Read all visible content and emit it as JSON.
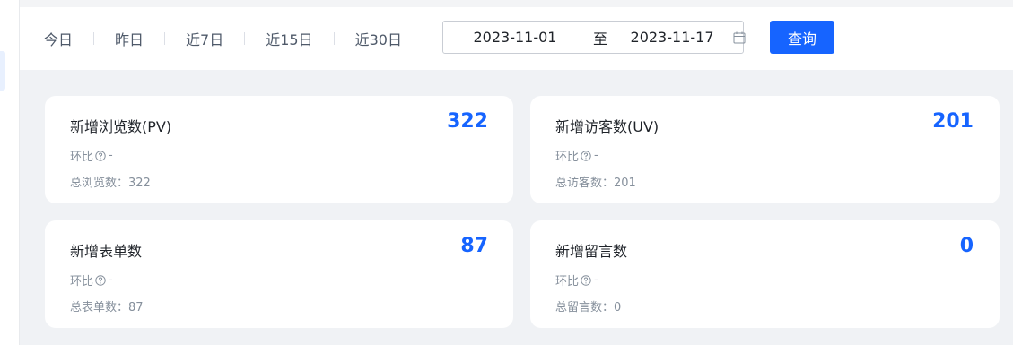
{
  "filters": {
    "ranges": [
      "今日",
      "昨日",
      "近7日",
      "近15日",
      "近30日"
    ],
    "start_date": "2023-11-01",
    "separator": "至",
    "end_date": "2023-11-17",
    "query_label": "查询"
  },
  "cards": [
    {
      "title": "新增浏览数(PV)",
      "value": "322",
      "ratio_label": "环比",
      "ratio_value": "-",
      "total_label": "总浏览数：",
      "total_value": "322"
    },
    {
      "title": "新增访客数(UV)",
      "value": "201",
      "ratio_label": "环比",
      "ratio_value": "-",
      "total_label": "总访客数：",
      "total_value": "201"
    },
    {
      "title": "新增表单数",
      "value": "87",
      "ratio_label": "环比",
      "ratio_value": "-",
      "total_label": "总表单数：",
      "total_value": "87"
    },
    {
      "title": "新增留言数",
      "value": "0",
      "ratio_label": "环比",
      "ratio_value": "-",
      "total_label": "总留言数：",
      "total_value": "0"
    }
  ],
  "colors": {
    "accent": "#1664ff",
    "background": "#f0f2f5",
    "muted_text": "#86909c"
  }
}
